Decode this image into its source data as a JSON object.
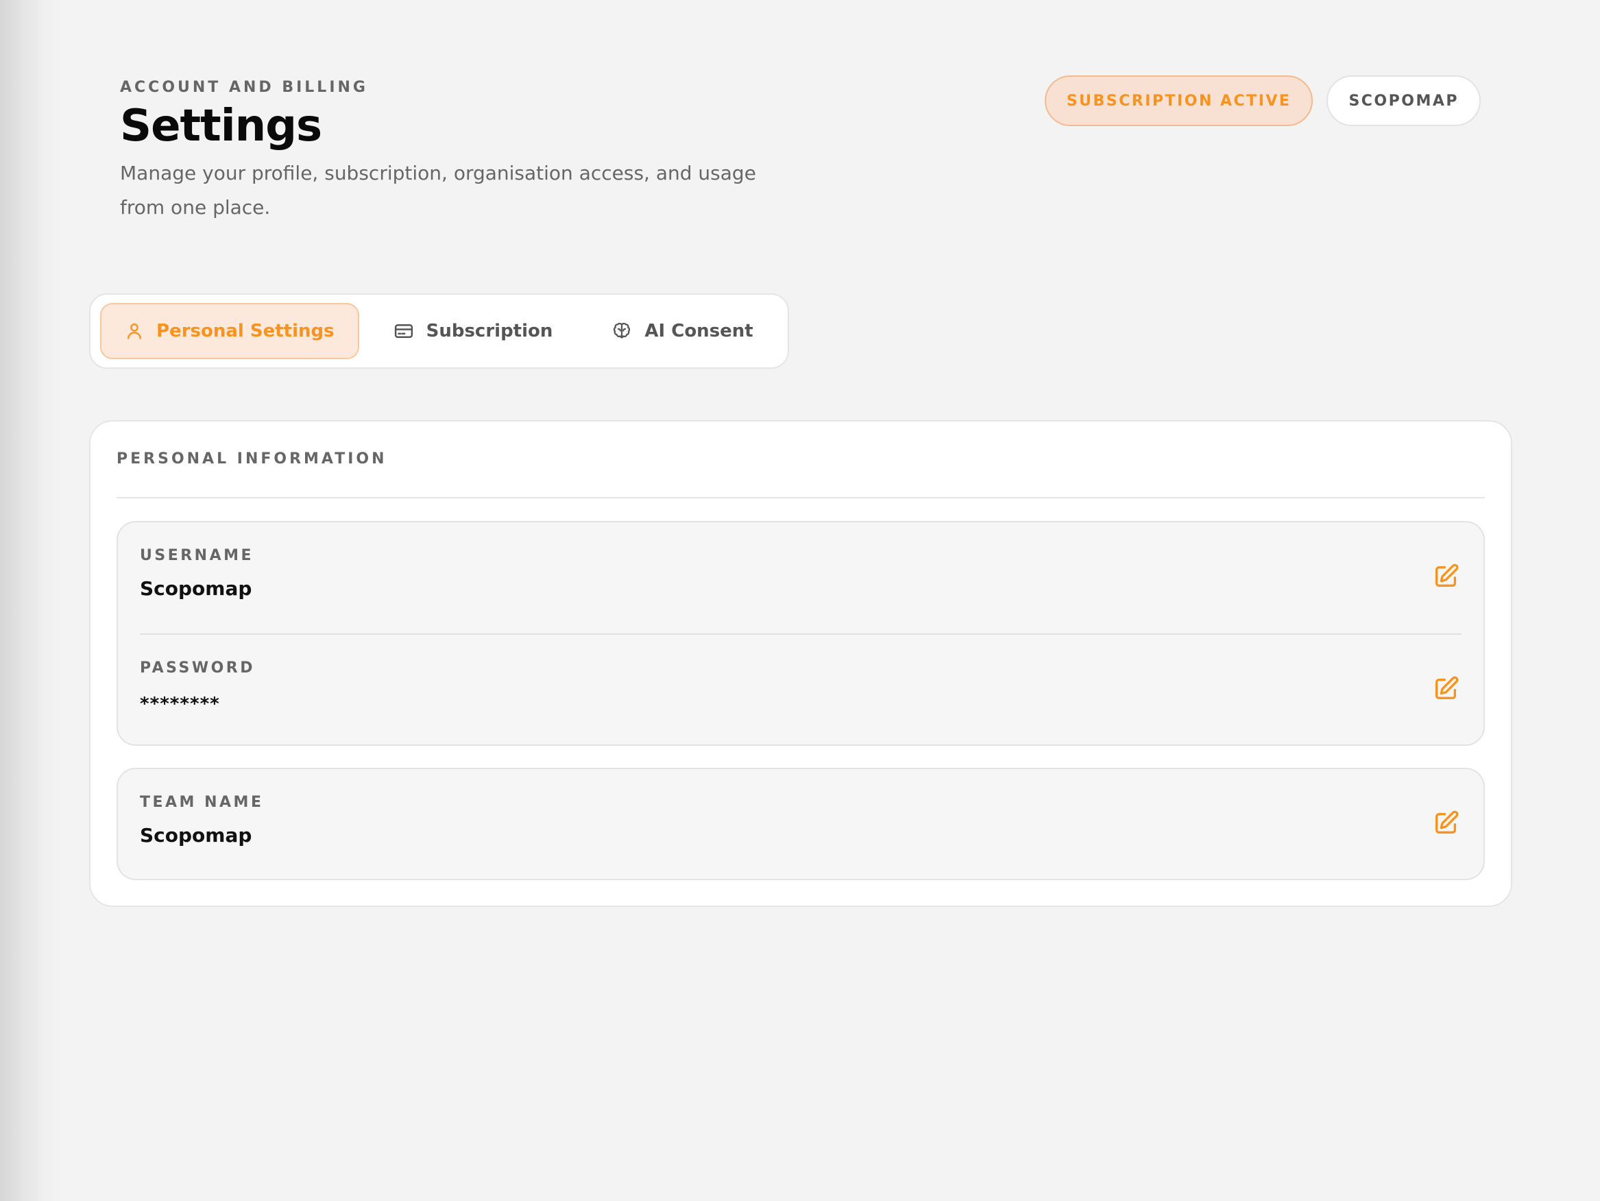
{
  "header": {
    "eyebrow": "ACCOUNT AND BILLING",
    "title": "Settings",
    "description": "Manage your profile, subscription, organisation access, and usage from one place."
  },
  "status": {
    "subscription_label": "SUBSCRIPTION ACTIVE",
    "organisation_label": "SCOPOMAP"
  },
  "tabs": [
    {
      "label": "Personal Settings",
      "icon": "user-icon",
      "active": true
    },
    {
      "label": "Subscription",
      "icon": "credit-card-icon",
      "active": false
    },
    {
      "label": "AI Consent",
      "icon": "brain-icon",
      "active": false
    }
  ],
  "personal_info": {
    "title": "PERSONAL INFORMATION",
    "fields": [
      {
        "label": "USERNAME",
        "value": "Scopomap",
        "action_icon": "edit-icon"
      },
      {
        "label": "PASSWORD",
        "value": "********",
        "action_icon": "edit-icon"
      },
      {
        "label": "TEAM NAME",
        "value": "Scopomap",
        "action_icon": "edit-icon"
      }
    ]
  },
  "colors": {
    "accent": "#f7931e",
    "accent_bg": "#fde9dc",
    "background": "#f3f3f3",
    "card": "#ffffff",
    "muted_text": "#666666"
  }
}
